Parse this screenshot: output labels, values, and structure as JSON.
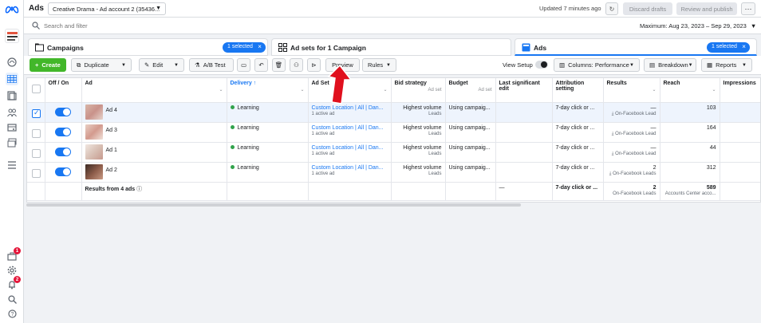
{
  "app": {
    "title": "Ads",
    "account": "Creative Drama - Ad account 2 (35436...",
    "updated": "Updated 7 minutes ago",
    "discard_label": "Discard drafts",
    "review_label": "Review and publish"
  },
  "search": {
    "placeholder": "Search and filter",
    "date_range": "Maximum: Aug 23, 2023 – Sep 29, 2023"
  },
  "tabs": {
    "campaigns": "Campaigns",
    "campaigns_selected": "1 selected",
    "adsets": "Ad sets for 1 Campaign",
    "ads": "Ads",
    "ads_selected": "1 selected"
  },
  "toolbar": {
    "create": "Create",
    "duplicate": "Duplicate",
    "edit": "Edit",
    "ab_test": "A/B Test",
    "preview": "Preview",
    "rules": "Rules",
    "view_setup": "View Setup",
    "columns": "Columns: Performance",
    "breakdown": "Breakdown",
    "reports": "Reports"
  },
  "table": {
    "headers": {
      "offon": "Off / On",
      "ad": "Ad",
      "delivery": "Delivery ↑",
      "adset": "Ad Set",
      "bid": "Bid strategy",
      "bid_sub": "Ad set",
      "budget": "Budget",
      "budget_sub": "Ad set",
      "last_edit": "Last significant edit",
      "attribution": "Attribution setting",
      "results": "Results",
      "reach": "Reach",
      "impressions": "Impressions"
    },
    "rows": [
      {
        "name": "Ad 4",
        "delivery": "Learning",
        "adset": "Custom Location | All | Dan...",
        "adset_sub": "1 active ad",
        "bid": "Highest volume",
        "bid_sub": "Leads",
        "budget": "Using campaig...",
        "attribution": "7-day click or ...",
        "results": "—",
        "results_sub": "On-Facebook Lead",
        "reach": "103",
        "selected": true
      },
      {
        "name": "Ad 3",
        "delivery": "Learning",
        "adset": "Custom Location | All | Dan...",
        "adset_sub": "1 active ad",
        "bid": "Highest volume",
        "bid_sub": "Leads",
        "budget": "Using campaig...",
        "attribution": "7-day click or ...",
        "results": "—",
        "results_sub": "On-Facebook Lead",
        "reach": "164",
        "selected": false
      },
      {
        "name": "Ad 1",
        "delivery": "Learning",
        "adset": "Custom Location | All | Dan...",
        "adset_sub": "1 active ad",
        "bid": "Highest volume",
        "bid_sub": "Leads",
        "budget": "Using campaig...",
        "attribution": "7-day click or ...",
        "results": "—",
        "results_sub": "On-Facebook Lead",
        "reach": "44",
        "selected": false
      },
      {
        "name": "Ad 2",
        "delivery": "Learning",
        "adset": "Custom Location | All | Dan...",
        "adset_sub": "1 active ad",
        "bid": "Highest volume",
        "bid_sub": "Leads",
        "budget": "Using campaig...",
        "attribution": "7-day click or ...",
        "results": "2",
        "results_sub": "On-Facebook Leads",
        "reach": "312",
        "selected": false
      }
    ],
    "totals": {
      "label": "Results from 4 ads",
      "last_edit": "—",
      "attribution": "7-day click or ...",
      "results": "2",
      "results_sub": "On-Facebook Leads",
      "reach": "589",
      "reach_sub": "Accounts Center acco..."
    }
  },
  "rail": {
    "notif_badge_1": "1",
    "notif_badge_2": "2"
  },
  "colors": {
    "accent": "#1877f2",
    "create": "#42b72a",
    "learning": "#31a24c",
    "annotation": "#e0101e"
  }
}
